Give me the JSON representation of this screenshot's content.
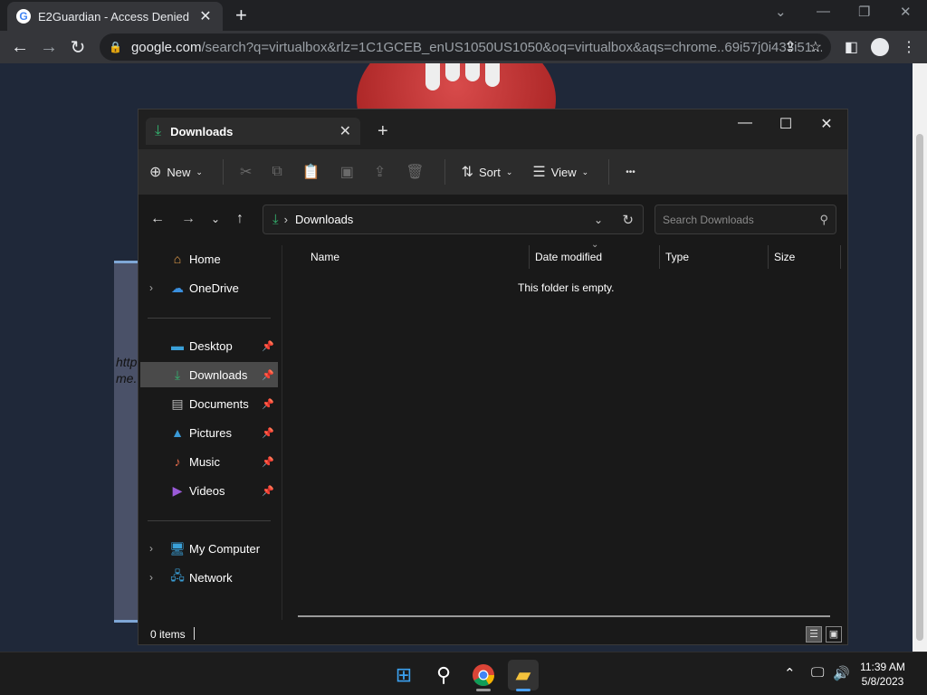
{
  "browser": {
    "tab_title": "E2Guardian - Access Denied",
    "favicon": "G",
    "url_host": "google.com",
    "url_rest": "/search?q=virtualbox&rlz=1C1GCEB_enUS1050US1050&oq=virtualbox&aqs=chrome..69i57j0i433i51...",
    "blocked_page_text_1": "http",
    "blocked_page_text_2": "me."
  },
  "explorer": {
    "tab_title": "Downloads",
    "toolbar": {
      "new_label": "New",
      "sort_label": "Sort",
      "view_label": "View",
      "more_label": "•••"
    },
    "address": {
      "location": "Downloads",
      "search_placeholder": "Search Downloads"
    },
    "nav": {
      "home": "Home",
      "onedrive": "OneDrive",
      "desktop": "Desktop",
      "downloads": "Downloads",
      "documents": "Documents",
      "pictures": "Pictures",
      "music": "Music",
      "videos": "Videos",
      "my_computer": "My Computer",
      "network": "Network"
    },
    "columns": {
      "name": "Name",
      "date_modified": "Date modified",
      "type": "Type",
      "size": "Size"
    },
    "empty_message": "This folder is empty.",
    "status": {
      "items": "0 items"
    }
  },
  "taskbar": {
    "time": "11:39 AM",
    "date": "5/8/2023"
  },
  "colors": {
    "accent_green": "#34b36f",
    "explorer_bg": "#191919",
    "page_bg": "#1f2839"
  }
}
